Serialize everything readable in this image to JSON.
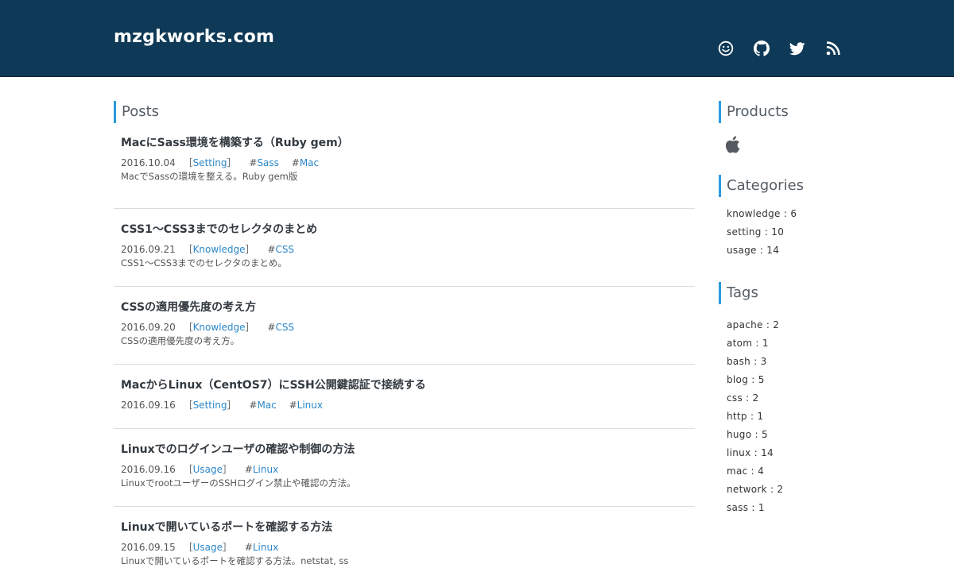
{
  "header": {
    "site_title": "mzgkworks.com",
    "icons": [
      "smiley-icon",
      "github-icon",
      "twitter-icon",
      "rss-icon"
    ]
  },
  "posts": {
    "heading": "Posts",
    "items": [
      {
        "title": "MacにSass環境を構築する（Ruby gem）",
        "date": "2016.10.04",
        "category": "Setting",
        "tags": [
          "Sass",
          "Mac"
        ],
        "description": "MacでSassの環境を整える。Ruby gem版"
      },
      {
        "title": "CSS1〜CSS3までのセレクタのまとめ",
        "date": "2016.09.21",
        "category": "Knowledge",
        "tags": [
          "CSS"
        ],
        "description": "CSS1〜CSS3までのセレクタのまとめ。"
      },
      {
        "title": "CSSの適用優先度の考え方",
        "date": "2016.09.20",
        "category": "Knowledge",
        "tags": [
          "CSS"
        ],
        "description": "CSSの適用優先度の考え方。"
      },
      {
        "title": "MacからLinux（CentOS7）にSSH公開鍵認証で接続する",
        "date": "2016.09.16",
        "category": "Setting",
        "tags": [
          "Mac",
          "Linux"
        ],
        "description": ""
      },
      {
        "title": "Linuxでのログインユーザの確認や制御の方法",
        "date": "2016.09.16",
        "category": "Usage",
        "tags": [
          "Linux"
        ],
        "description": "LinuxでrootユーザーのSSHログイン禁止や確認の方法。"
      },
      {
        "title": "Linuxで開いているポートを確認する方法",
        "date": "2016.09.15",
        "category": "Usage",
        "tags": [
          "Linux"
        ],
        "description": "Linuxで開いているポートを確認する方法。netstat, ss"
      }
    ]
  },
  "sidebar": {
    "products_heading": "Products",
    "product_icon": "apple-icon",
    "categories_heading": "Categories",
    "categories": [
      {
        "name": "knowledge",
        "count": "6"
      },
      {
        "name": "setting",
        "count": "10"
      },
      {
        "name": "usage",
        "count": "14"
      }
    ],
    "tags_heading": "Tags",
    "tags": [
      {
        "name": "apache",
        "count": "2"
      },
      {
        "name": "atom",
        "count": "1"
      },
      {
        "name": "bash",
        "count": "3"
      },
      {
        "name": "blog",
        "count": "5"
      },
      {
        "name": "css",
        "count": "2"
      },
      {
        "name": "http",
        "count": "1"
      },
      {
        "name": "hugo",
        "count": "5"
      },
      {
        "name": "linux",
        "count": "14"
      },
      {
        "name": "mac",
        "count": "4"
      },
      {
        "name": "network",
        "count": "2"
      },
      {
        "name": "sass",
        "count": "1"
      }
    ]
  },
  "colors": {
    "header_bg": "#0f3a57",
    "accent": "#2b9be0",
    "link": "#2b87c9"
  }
}
